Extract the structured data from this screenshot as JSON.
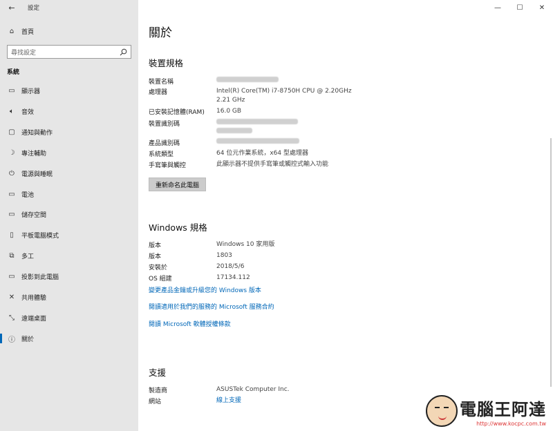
{
  "window": {
    "title": "設定",
    "controls": {
      "minimize": "—",
      "maximize": "☐",
      "close": "✕"
    }
  },
  "sidebar": {
    "home_label": "首頁",
    "search_placeholder": "尋找設定",
    "section": "系統",
    "items": [
      {
        "icon": "monitor-icon",
        "glyph": "▭",
        "label": "顯示器"
      },
      {
        "icon": "speaker-icon",
        "glyph": "🔈︎",
        "label": "音效"
      },
      {
        "icon": "notification-icon",
        "glyph": "▢",
        "label": "通知與動作"
      },
      {
        "icon": "moon-icon",
        "glyph": "☽",
        "label": "專注輔助"
      },
      {
        "icon": "power-icon",
        "glyph": "⏻",
        "label": "電源與睡眠"
      },
      {
        "icon": "battery-icon",
        "glyph": "▭",
        "label": "電池"
      },
      {
        "icon": "storage-icon",
        "glyph": "▭",
        "label": "儲存空間"
      },
      {
        "icon": "tablet-icon",
        "glyph": "▯",
        "label": "平板電腦模式"
      },
      {
        "icon": "multitask-icon",
        "glyph": "⧉",
        "label": "多工"
      },
      {
        "icon": "project-icon",
        "glyph": "▭",
        "label": "投影到此電腦"
      },
      {
        "icon": "shared-icon",
        "glyph": "✕",
        "label": "共用體驗"
      },
      {
        "icon": "remote-icon",
        "glyph": "⤡",
        "label": "遠端桌面"
      },
      {
        "icon": "info-icon",
        "glyph": "ⓘ",
        "label": "關於"
      }
    ],
    "active_index": 12
  },
  "main": {
    "title": "關於",
    "device": {
      "heading": "裝置規格",
      "device_name_label": "裝置名稱",
      "processor_label": "處理器",
      "processor_value_1": "Intel(R) Core(TM) i7-8750H CPU @ 2.20GHz",
      "processor_value_2": "2.21 GHz",
      "ram_label": "已安裝記憶體(RAM)",
      "ram_value": "16.0 GB",
      "device_id_label": "裝置識別碼",
      "product_id_label": "產品識別碼",
      "system_type_label": "系統類型",
      "system_type_value": "64 位元作業系統，x64 型處理器",
      "pen_label": "手寫筆與觸控",
      "pen_value": "此顯示器不提供手寫筆或觸控式輸入功能",
      "rename_button": "重新命名此電腦"
    },
    "windows": {
      "heading": "Windows 規格",
      "edition_label": "版本",
      "edition_value": "Windows 10 家用版",
      "version_label": "版本",
      "version_value": "1803",
      "installed_label": "安裝於",
      "installed_value": "2018/5/6",
      "build_label": "OS 組建",
      "build_value": "17134.112",
      "link_1": "變更產品金鑰或升級您的 Windows 版本",
      "link_2": "閱讀適用於我們的服務的 Microsoft 服務合約",
      "link_3": "閱讀 Microsoft 軟體授權條款"
    },
    "support": {
      "heading": "支援",
      "maker_label": "製造商",
      "maker_value": "ASUSTek Computer Inc.",
      "site_label": "網站",
      "site_value": "線上支援"
    }
  },
  "watermark": {
    "title": "電腦王阿達",
    "url": "http://www.kocpc.com.tw"
  }
}
